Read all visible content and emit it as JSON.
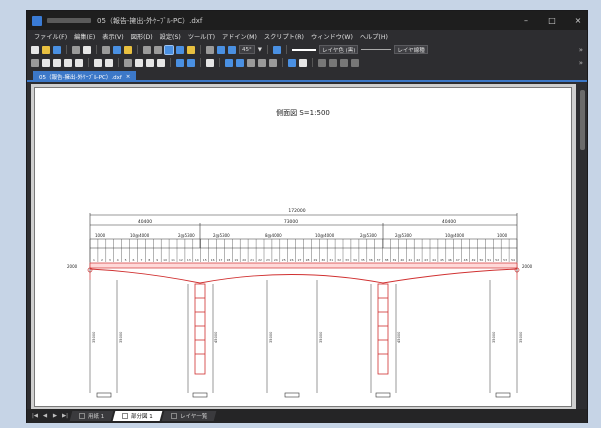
{
  "window": {
    "title": "05（報告-擁出-外ｹｰﾌﾞﾙ-PC）.dxf",
    "controls": {
      "minimize": "–",
      "maximize": "□",
      "close": "×"
    }
  },
  "menu": [
    "ファイル(F)",
    "編集(E)",
    "表示(V)",
    "図形(D)",
    "設定(S)",
    "ツール(T)",
    "アドイン(M)",
    "スクリプト(R)",
    "ウィンドウ(W)",
    "ヘルプ(H)"
  ],
  "toolbar": {
    "angle": "45°",
    "layer_color": "レイヤ色 (黒)",
    "linetype": "レイヤ線種",
    "colors": {
      "blue": "#4a90e2",
      "yellow": "#e8c040",
      "white": "#e6e6e6",
      "red": "#d84a4a",
      "green": "#4caf50",
      "gray": "#9a9a9a"
    }
  },
  "tab": {
    "label": "05（報告-擁出-外ｹｰﾌﾞﾙ-PC）.dxf",
    "close": "×"
  },
  "drawing": {
    "title": "側面図  S=1:500",
    "dims": {
      "total": "172000",
      "spans": [
        "40400",
        "73000",
        "40400"
      ],
      "lines": {
        "l1a": "10@4000",
        "l1b": "2@5300",
        "l1c": "2@5300",
        "l1d": "8@4000",
        "l1e": "10@4000",
        "l1f": "2@5300",
        "l1g": "2@5300",
        "l1h": "10@4000"
      },
      "left_end": "1000",
      "right_end": "1000",
      "level_left": "2000",
      "level_right": "2000",
      "pier_heights": [
        "35000",
        "35000",
        "45000",
        "35000",
        "35000",
        "45000",
        "35000",
        "35000"
      ]
    }
  },
  "sheet_tabs": [
    {
      "label": "用紙 1",
      "active": false
    },
    {
      "label": "部分図 1",
      "active": true
    },
    {
      "label": "レイヤ一覧",
      "active": false
    }
  ],
  "nav": [
    "|◀",
    "◀",
    "▶",
    "▶|"
  ]
}
